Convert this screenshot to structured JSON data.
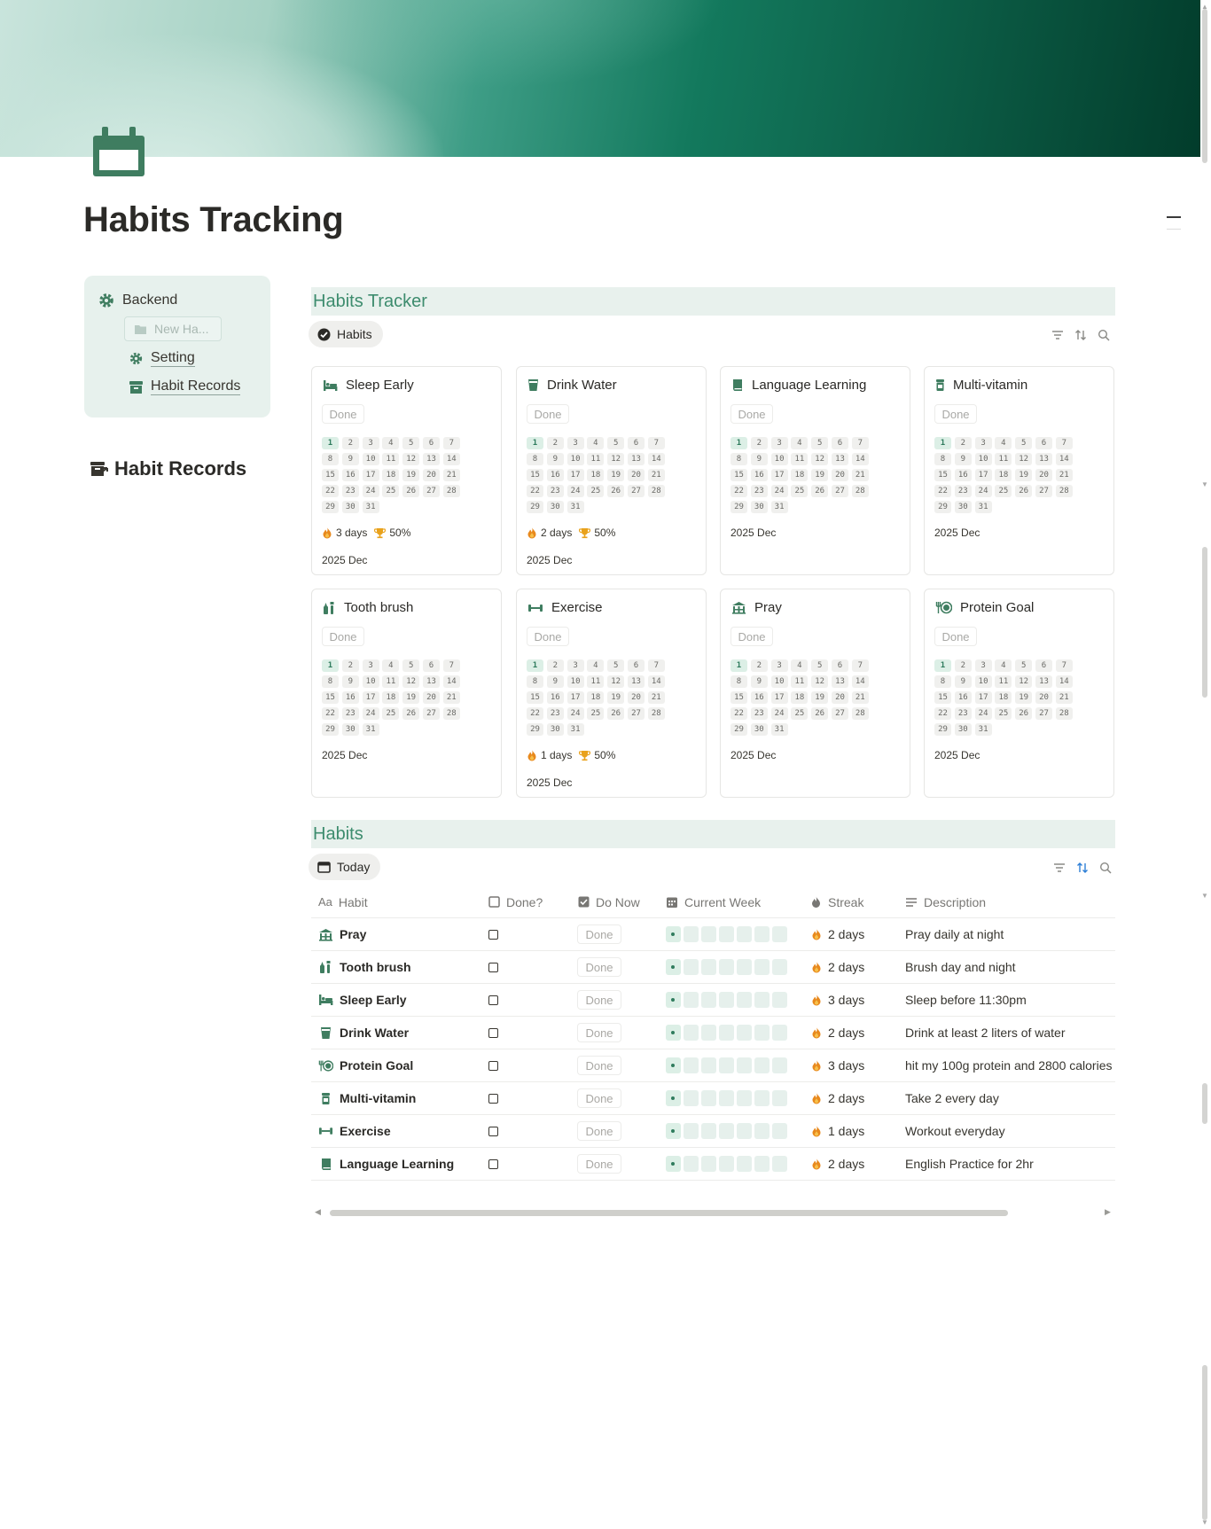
{
  "page": {
    "title": "Habits Tracking"
  },
  "sidebar": {
    "backend_label": "Backend",
    "new_habit_label": "New Ha...",
    "setting_label": "Setting",
    "records_label": "Habit Records"
  },
  "records_heading": "Habit Records",
  "tracker": {
    "heading": "Habits Tracker",
    "view_label": "Habits",
    "done_label": "Done",
    "cal_days": [
      "1",
      "2",
      "3",
      "4",
      "5",
      "6",
      "7",
      "8",
      "9",
      "10",
      "11",
      "12",
      "13",
      "14",
      "15",
      "16",
      "17",
      "18",
      "19",
      "20",
      "21",
      "22",
      "23",
      "24",
      "25",
      "26",
      "27",
      "28",
      "29",
      "30",
      "31"
    ],
    "cards": [
      {
        "name": "Sleep Early",
        "icon": "bed-icon",
        "streak": "3 days",
        "rate": "50%",
        "month": "2025 Dec"
      },
      {
        "name": "Drink Water",
        "icon": "cup-icon",
        "streak": "2 days",
        "rate": "50%",
        "month": "2025 Dec"
      },
      {
        "name": "Language Learning",
        "icon": "book-icon",
        "month": "2025 Dec"
      },
      {
        "name": "Multi-vitamin",
        "icon": "pill-bottle-icon",
        "month": "2025 Dec"
      },
      {
        "name": "Tooth brush",
        "icon": "toothbrush-icon",
        "month": "2025 Dec"
      },
      {
        "name": "Exercise",
        "icon": "dumbbell-icon",
        "streak": "1 days",
        "rate": "50%",
        "month": "2025 Dec"
      },
      {
        "name": "Pray",
        "icon": "temple-icon",
        "month": "2025 Dec"
      },
      {
        "name": "Protein Goal",
        "icon": "plate-icon",
        "month": "2025 Dec"
      }
    ]
  },
  "habits_table": {
    "heading": "Habits",
    "view_label": "Today",
    "columns": [
      "Habit",
      "Done?",
      "Do Now",
      "Current Week",
      "Streak",
      "Description"
    ],
    "done_label": "Done",
    "rows": [
      {
        "name": "Pray",
        "icon": "temple-icon",
        "streak": "2 days",
        "description": "Pray daily at night"
      },
      {
        "name": "Tooth brush",
        "icon": "toothbrush-icon",
        "streak": "2 days",
        "description": "Brush day and night"
      },
      {
        "name": "Sleep Early",
        "icon": "bed-icon",
        "streak": "3 days",
        "description": "Sleep before 11:30pm"
      },
      {
        "name": "Drink Water",
        "icon": "cup-icon",
        "streak": "2 days",
        "description": "Drink at least 2 liters of water"
      },
      {
        "name": "Protein Goal",
        "icon": "plate-icon",
        "streak": "3 days",
        "description": "hit my 100g protein and 2800 calories"
      },
      {
        "name": "Multi-vitamin",
        "icon": "pill-bottle-icon",
        "streak": "2 days",
        "description": "Take 2 every day"
      },
      {
        "name": "Exercise",
        "icon": "dumbbell-icon",
        "streak": "1 days",
        "description": "Workout everyday"
      },
      {
        "name": "Language Learning",
        "icon": "book-icon",
        "streak": "2 days",
        "description": "English Practice for 2hr"
      }
    ]
  },
  "colors": {
    "accent": "#3d8c6e",
    "section_bg": "#e8f1ed",
    "sidebar_bg": "#e7f1ed",
    "streak_fire": "#e8891d",
    "icon_green": "#3f7d60"
  }
}
